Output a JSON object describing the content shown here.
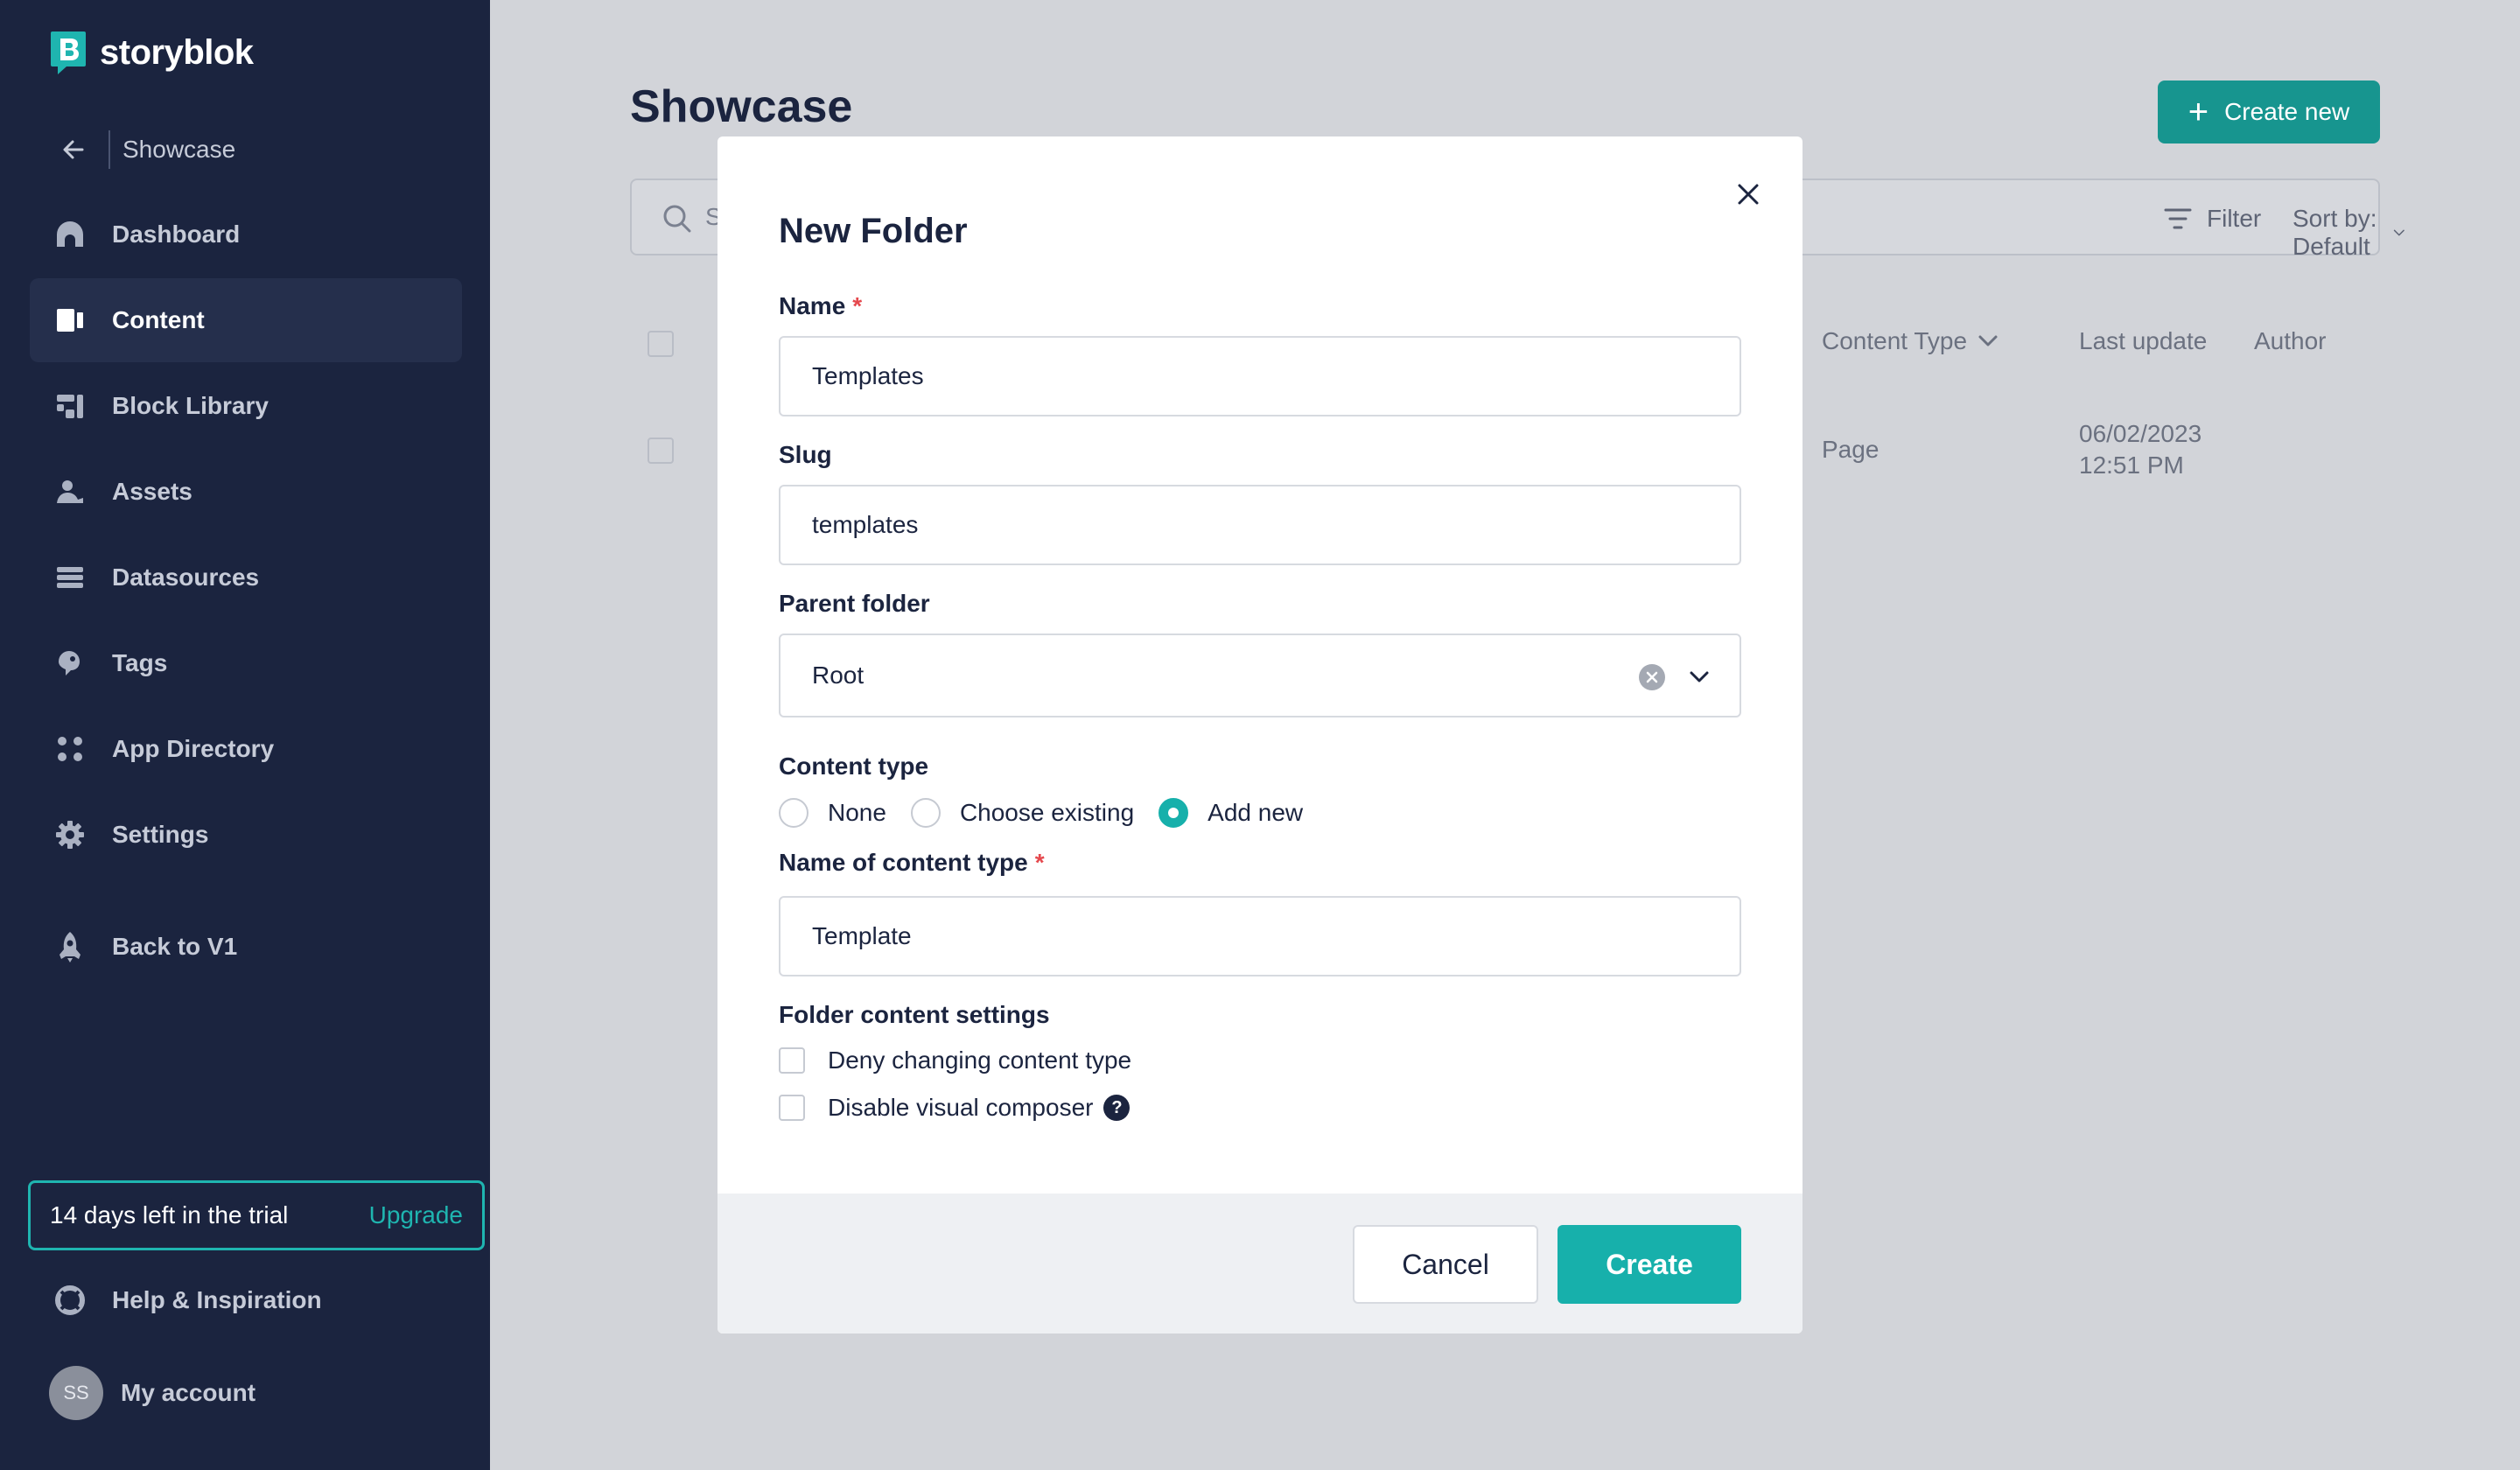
{
  "brand": {
    "name": "storyblok",
    "accent": "#17b0ab"
  },
  "sidebar": {
    "space_name": "Showcase",
    "items": [
      {
        "label": "Dashboard",
        "icon": "dashboard-icon"
      },
      {
        "label": "Content",
        "icon": "content-icon",
        "active": true
      },
      {
        "label": "Block Library",
        "icon": "block-library-icon"
      },
      {
        "label": "Assets",
        "icon": "assets-icon"
      },
      {
        "label": "Datasources",
        "icon": "datasources-icon"
      },
      {
        "label": "Tags",
        "icon": "tags-icon"
      },
      {
        "label": "App Directory",
        "icon": "app-directory-icon"
      },
      {
        "label": "Settings",
        "icon": "gear-icon"
      },
      {
        "label": "Back to V1",
        "icon": "rocket-icon"
      }
    ],
    "trial_text": "14 days left in the trial",
    "upgrade_label": "Upgrade",
    "help_label": "Help & Inspiration",
    "account_label": "My account",
    "avatar_initials": "SS"
  },
  "main": {
    "title": "Showcase",
    "create_new_label": "Create new",
    "search_placeholder": "S",
    "filter_label": "Filter",
    "sort_label": "Sort by: Default",
    "columns": {
      "content_type": "Content Type",
      "last_update": "Last update",
      "author": "Author"
    },
    "rows": [
      {
        "content_type": "Page",
        "last_update_date": "06/02/2023",
        "last_update_time": "12:51 PM",
        "author": ""
      }
    ]
  },
  "modal": {
    "title": "New Folder",
    "name_label": "Name",
    "name_value": "Templates",
    "slug_label": "Slug",
    "slug_value": "templates",
    "parent_label": "Parent folder",
    "parent_value": "Root",
    "content_type_label": "Content type",
    "content_type_options": [
      "None",
      "Choose existing",
      "Add new"
    ],
    "content_type_selected": "Add new",
    "ct_name_label": "Name of content type",
    "ct_name_value": "Template",
    "settings_label": "Folder content settings",
    "settings": [
      {
        "label": "Deny changing content type",
        "checked": false
      },
      {
        "label": "Disable visual composer",
        "checked": false
      }
    ],
    "required_mark": "*",
    "help_mark": "?",
    "cancel_label": "Cancel",
    "create_label": "Create"
  }
}
